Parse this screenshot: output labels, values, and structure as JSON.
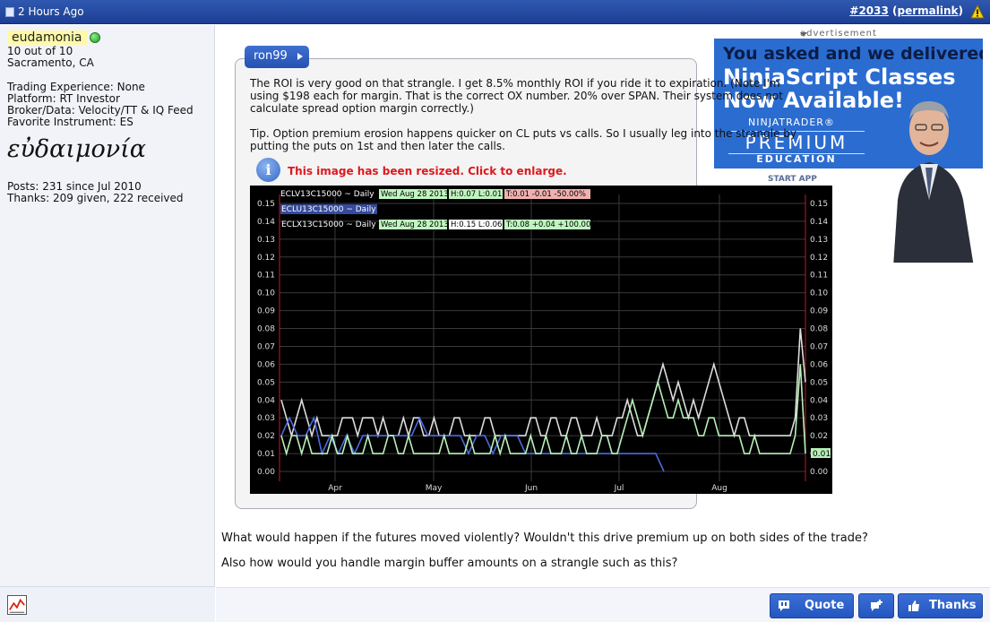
{
  "header": {
    "time": "2 Hours Ago",
    "post_number": "#2033",
    "permalink": "permalink",
    "open_paren": "(",
    "close_paren": ")"
  },
  "user": {
    "name": "eudamonia",
    "rating": "10 out of 10",
    "location": "Sacramento, CA",
    "trading_experience": "Trading Experience: None",
    "platform": "Platform: RT Investor",
    "broker": "Broker/Data: Velocity/TT & IQ Feed",
    "instrument": "Favorite Instrument: ES",
    "greek_signature": "εὐδαιμονία",
    "posts": "Posts: 231 since Jul 2010",
    "thanks": "Thanks: 209 given, 222 received"
  },
  "quote": {
    "author": "ron99",
    "para1": "The ROI is very good on that strangle. I get 8.5% monthly ROI if you ride it to expiration. (Note I'm using $198 each for margin. That is the correct OX number. 20% over SPAN. Their system does not calculate spread option margin correctly.)",
    "para2": "Tip. Option premium erosion happens quicker on CL puts vs calls. So I usually leg into the strangle by putting the puts on 1st and then later the calls.",
    "resize_message": "This image has been resized.  Click to enlarge."
  },
  "ad": {
    "label": "advertisement",
    "line1": "You asked and we delivered",
    "line2": "NinjaScript Classes",
    "line3": "Now Available!",
    "brand": "NINJATRADER®",
    "premium": "PREMIUM",
    "education": "EDUCATION",
    "start": "START APP"
  },
  "message": {
    "line1": "What would happen if the futures moved violently? Wouldn't this drive premium up on both sides of the trade?",
    "line2": "Also how would you handle margin buffer amounts on a strangle such as this?"
  },
  "buttons": {
    "quote": "Quote",
    "thanks": "Thanks"
  },
  "colors": {
    "header": "#2f58b0",
    "button": "#2a5cc5",
    "alert_red": "#e0171d"
  },
  "chart_data": {
    "type": "line",
    "legend": [
      {
        "label": "ECLV13C15000 ~ Daily",
        "date": "Wed Aug 28 2013",
        "h": "H:0.07",
        "l": "L:0.01",
        "t": "T:0.01",
        "chg": "-0.01",
        "pct": "-50.00%",
        "color": "#ffffff"
      },
      {
        "label": "ECLU13C15000 ~ Daily",
        "color": "#5a78e8"
      },
      {
        "label": "ECLX13C15000 ~ Daily",
        "date": "Wed Aug 28 2013",
        "h": "H:0.15",
        "l": "L:0.06",
        "t": "T:0.08",
        "chg": "+0.04",
        "pct": "+100.00%",
        "color": "#a8e8a8"
      }
    ],
    "x_labels": [
      "Apr",
      "May",
      "Jun",
      "Jul",
      "Aug"
    ],
    "y_ticks": [
      "0.00",
      "0.01",
      "0.02",
      "0.03",
      "0.04",
      "0.05",
      "0.06",
      "0.07",
      "0.08",
      "0.09",
      "0.10",
      "0.11",
      "0.12",
      "0.13",
      "0.14",
      "0.15"
    ],
    "ylim": [
      0,
      0.15
    ],
    "last_value_label": "0.01",
    "series": [
      {
        "name": "ECLV13C15000 ~ Daily",
        "color": "#dddddd",
        "values": [
          0.04,
          0.03,
          0.02,
          0.03,
          0.04,
          0.03,
          0.02,
          0.03,
          0.02,
          0.02,
          0.02,
          0.02,
          0.03,
          0.03,
          0.03,
          0.02,
          0.03,
          0.03,
          0.03,
          0.02,
          0.03,
          0.02,
          0.02,
          0.02,
          0.03,
          0.02,
          0.03,
          0.03,
          0.02,
          0.02,
          0.03,
          0.02,
          0.02,
          0.02,
          0.03,
          0.03,
          0.02,
          0.02,
          0.02,
          0.02,
          0.03,
          0.03,
          0.02,
          0.02,
          0.02,
          0.02,
          0.02,
          0.02,
          0.02,
          0.03,
          0.03,
          0.02,
          0.02,
          0.03,
          0.03,
          0.02,
          0.02,
          0.03,
          0.03,
          0.02,
          0.02,
          0.02,
          0.03,
          0.02,
          0.02,
          0.02,
          0.03,
          0.03,
          0.04,
          0.03,
          0.02,
          0.02,
          0.03,
          0.04,
          0.05,
          0.06,
          0.05,
          0.04,
          0.05,
          0.04,
          0.03,
          0.04,
          0.03,
          0.04,
          0.05,
          0.06,
          0.05,
          0.04,
          0.03,
          0.02,
          0.03,
          0.03,
          0.02,
          0.02,
          0.02,
          0.02,
          0.02,
          0.02,
          0.02,
          0.02,
          0.02,
          0.03,
          0.08,
          0.05
        ]
      },
      {
        "name": "ECLU13C15000 ~ Daily",
        "color": "#4a6ae0",
        "values": [
          0.02,
          0.03,
          0.02,
          0.02,
          0.03,
          0.01,
          0.02,
          0.01,
          0.02,
          0.01,
          0.02,
          0.02,
          0.02,
          0.02,
          0.02,
          0.02,
          0.02,
          0.03,
          0.02,
          0.02,
          0.02,
          0.02,
          0.02,
          0.01,
          0.02,
          0.02,
          0.01,
          0.02,
          0.02,
          0.02,
          0.01,
          0.01,
          0.01,
          0.01,
          0.01,
          0.01,
          0.01,
          0.01,
          0.01,
          0.01,
          0.01,
          0.01,
          0.01,
          0.01,
          0.01,
          0.01,
          0.01,
          0.0
        ]
      },
      {
        "name": "ECLX13C15000 ~ Daily",
        "color": "#b8f0b8",
        "values": [
          0.02,
          0.01,
          0.02,
          0.02,
          0.01,
          0.02,
          0.01,
          0.01,
          0.01,
          0.01,
          0.02,
          0.01,
          0.01,
          0.02,
          0.01,
          0.01,
          0.01,
          0.02,
          0.01,
          0.01,
          0.01,
          0.02,
          0.02,
          0.01,
          0.01,
          0.02,
          0.01,
          0.01,
          0.01,
          0.01,
          0.01,
          0.01,
          0.02,
          0.01,
          0.01,
          0.01,
          0.01,
          0.02,
          0.01,
          0.01,
          0.01,
          0.01,
          0.02,
          0.01,
          0.02,
          0.01,
          0.01,
          0.01,
          0.01,
          0.02,
          0.01,
          0.01,
          0.02,
          0.01,
          0.01,
          0.01,
          0.02,
          0.01,
          0.01,
          0.02,
          0.01,
          0.01,
          0.01,
          0.02,
          0.02,
          0.01,
          0.01,
          0.02,
          0.03,
          0.04,
          0.03,
          0.02,
          0.03,
          0.04,
          0.05,
          0.04,
          0.03,
          0.03,
          0.04,
          0.03,
          0.03,
          0.03,
          0.02,
          0.02,
          0.03,
          0.03,
          0.02,
          0.02,
          0.02,
          0.02,
          0.02,
          0.01,
          0.01,
          0.02,
          0.01,
          0.01,
          0.01,
          0.01,
          0.01,
          0.01,
          0.01,
          0.02,
          0.06,
          0.01
        ]
      }
    ]
  }
}
